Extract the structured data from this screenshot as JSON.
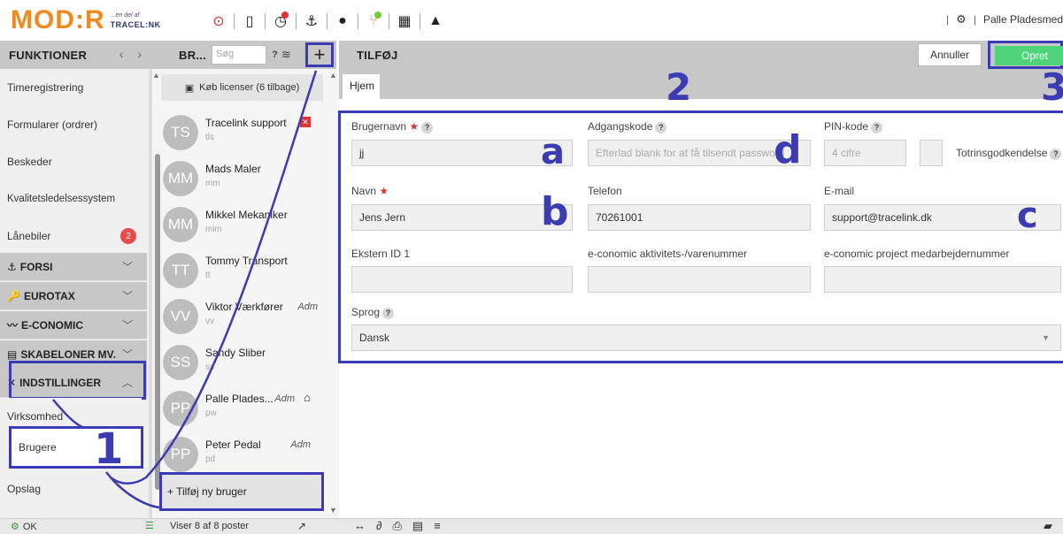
{
  "topbar": {
    "logo_main": "MOD:R",
    "logo_sub1": "...en del af",
    "logo_sub2": "TRACEL:NK",
    "user_name": "Palle Pladesmed",
    "settings_icon": "gear-icon"
  },
  "col1": {
    "title": "FUNKTIONER",
    "nav": "‹ ›",
    "items": [
      {
        "label": "Timeregistrering"
      },
      {
        "label": "Formularer (ordrer)"
      },
      {
        "label": "Beskeder"
      },
      {
        "label": "Kvalitetsledelsessystem"
      },
      {
        "label": "Lånebiler",
        "badge": "2"
      }
    ],
    "groups": [
      {
        "label": "FORSI",
        "icon": "⚓"
      },
      {
        "label": "EUROTAX",
        "icon": "🔑"
      },
      {
        "label": "E-CONOMIC",
        "icon": "〰"
      },
      {
        "label": "SKABELONER MV.",
        "icon": "▤"
      },
      {
        "label": "INDSTILLINGER",
        "icon": "✕"
      }
    ],
    "sub_items": [
      {
        "label": "Virksomhed"
      },
      {
        "label": "Brugere"
      },
      {
        "label": "Opslag"
      }
    ]
  },
  "col2": {
    "title": "BR...",
    "search_placeholder": "Søg",
    "help": "?",
    "add": "+",
    "licenses": "Køb licenser (6 tilbage)",
    "users": [
      {
        "initials": "TS",
        "name": "Tracelink support",
        "sub": "tls",
        "role": "",
        "flag": "x"
      },
      {
        "initials": "MM",
        "name": "Mads Maler",
        "sub": "mm",
        "role": "",
        "flag": ""
      },
      {
        "initials": "MM",
        "name": "Mikkel Mekaniker",
        "sub": "mim",
        "role": "",
        "flag": ""
      },
      {
        "initials": "TT",
        "name": "Tommy Transport",
        "sub": "tt",
        "role": "",
        "flag": ""
      },
      {
        "initials": "VV",
        "name": "Viktor Værkfører",
        "sub": "vv",
        "role": "Adm",
        "flag": ""
      },
      {
        "initials": "SS",
        "name": "Sandy Sliber",
        "sub": "ss",
        "role": "",
        "flag": ""
      },
      {
        "initials": "PP",
        "name": "Palle Plades...",
        "sub": "pw",
        "role": "Adm",
        "flag": "home"
      },
      {
        "initials": "PP",
        "name": "Peter Pedal",
        "sub": "pd",
        "role": "Adm",
        "flag": ""
      }
    ],
    "add_user": "+ Tilføj ny bruger"
  },
  "col3": {
    "title": "TILFØJ",
    "cancel": "Annuller",
    "create": "Opret",
    "tab": "Hjem"
  },
  "form": {
    "username_label": "Brugernavn",
    "username_value": "jj",
    "password_label": "Adgangskode",
    "password_placeholder": "Efterlad blank for at få tilsendt password",
    "pin_label": "PIN-kode",
    "pin_placeholder": "4 cifre",
    "twofactor_label": "Totrinsgodkendelse",
    "name_label": "Navn",
    "name_value": "Jens Jern",
    "phone_label": "Telefon",
    "phone_value": "70261001",
    "email_label": "E-mail",
    "email_value": "support@tracelink.dk",
    "extid_label": "Ekstern ID 1",
    "eco_activity_label": "e-conomic aktivitets-/varenummer",
    "eco_project_label": "e-conomic project medarbejdernummer",
    "lang_label": "Sprog",
    "lang_value": "Dansk"
  },
  "annotations": {
    "n1": "1",
    "n2": "2",
    "n3": "3",
    "a": "a",
    "b": "b",
    "c": "c",
    "d": "d",
    "color": "#3b3bb3"
  },
  "bottombar": {
    "status": "OK",
    "count": "Viser 8 af 8 poster"
  }
}
